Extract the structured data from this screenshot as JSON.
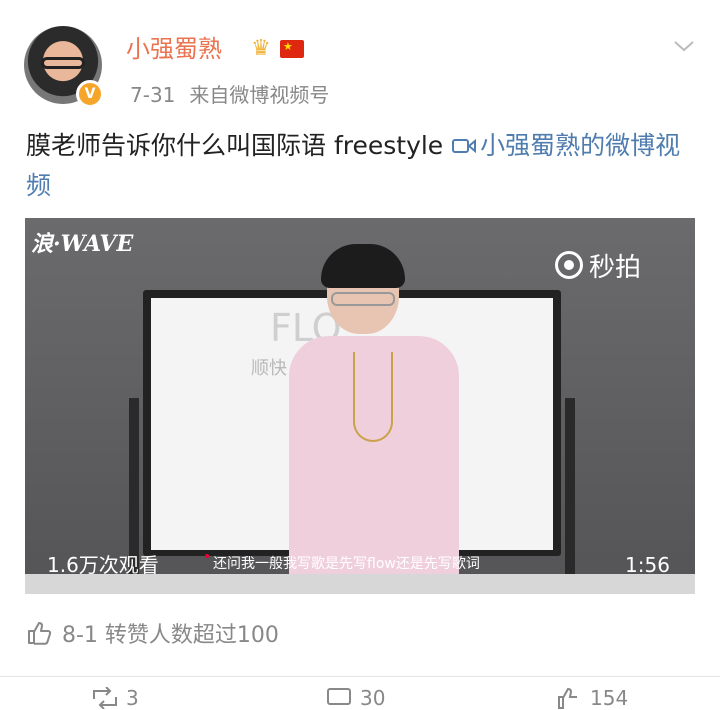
{
  "post": {
    "username": "小强蜀熟",
    "date": "7-31",
    "source": "来自微博视频号",
    "text": "膜老师告诉你什么叫国际语 freestyle ",
    "video_link": "小强蜀熟的微博视频"
  },
  "video": {
    "watermark_left": "浪·WAVE",
    "watermark_right": "秒拍",
    "board_text": "FLO",
    "board_text2": "顺快",
    "views": "1.6万次观看",
    "subtitle": "还问我一般我写歌是先写flow还是先写歌词",
    "duration": "1:56"
  },
  "likes_line": "8-1 转赞人数超过100",
  "actions": [
    {
      "icon": "repost-icon",
      "count": "3"
    },
    {
      "icon": "comment-icon",
      "count": "30"
    },
    {
      "icon": "like-icon",
      "count": "154"
    }
  ],
  "colors": {
    "username": "#eb7350",
    "link": "#507daf",
    "meta": "#888888"
  }
}
